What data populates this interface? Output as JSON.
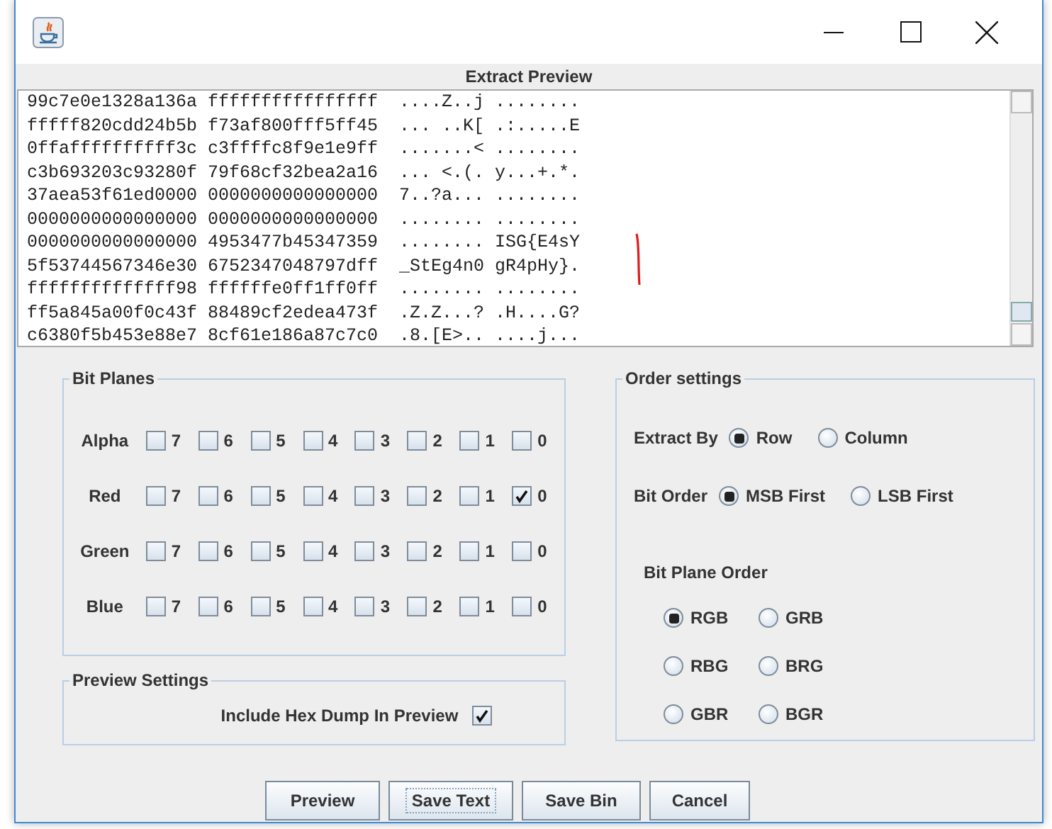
{
  "preview": {
    "title": "Extract Preview",
    "lines": [
      "99c7e0e1328a136a ffffffffffffffff  ....Z..j ........",
      "fffff820cdd24b5b f73af800fff5ff45  ... ..K[ .:.....E",
      "0ffaffffffffff3c c3ffffc8f9e1e9ff  .......< ........",
      "c3b693203c93280f 79f68cf32bea2a16  ... <.(. y...+.*.",
      "37aea53f61ed0000 0000000000000000  7..?a... ........",
      "0000000000000000 0000000000000000  ........ ........",
      "0000000000000000 4953477b45347359  ........ ISG{E4sY",
      "5f53744567346e30 6752347048797dff  _StEg4n0 gR4pHy}.",
      "ffffffffffffff98 ffffffe0ff1ff0ff  ........ ........",
      "ff5a845a00f0c43f 88489cf2edea473f  .Z.Z...? .H....G?",
      "c6380f5b453e88e7 8cf61e186a87c7c0  .8.[E>.. ....j..."
    ]
  },
  "bit_planes": {
    "title": "Bit Planes",
    "rows": [
      {
        "label": "Alpha",
        "bits": [
          {
            "label": "7",
            "checked": false
          },
          {
            "label": "6",
            "checked": false
          },
          {
            "label": "5",
            "checked": false
          },
          {
            "label": "4",
            "checked": false
          },
          {
            "label": "3",
            "checked": false
          },
          {
            "label": "2",
            "checked": false
          },
          {
            "label": "1",
            "checked": false
          },
          {
            "label": "0",
            "checked": false
          }
        ]
      },
      {
        "label": "Red",
        "bits": [
          {
            "label": "7",
            "checked": false
          },
          {
            "label": "6",
            "checked": false
          },
          {
            "label": "5",
            "checked": false
          },
          {
            "label": "4",
            "checked": false
          },
          {
            "label": "3",
            "checked": false
          },
          {
            "label": "2",
            "checked": false
          },
          {
            "label": "1",
            "checked": false
          },
          {
            "label": "0",
            "checked": true
          }
        ]
      },
      {
        "label": "Green",
        "bits": [
          {
            "label": "7",
            "checked": false
          },
          {
            "label": "6",
            "checked": false
          },
          {
            "label": "5",
            "checked": false
          },
          {
            "label": "4",
            "checked": false
          },
          {
            "label": "3",
            "checked": false
          },
          {
            "label": "2",
            "checked": false
          },
          {
            "label": "1",
            "checked": false
          },
          {
            "label": "0",
            "checked": false
          }
        ]
      },
      {
        "label": "Blue",
        "bits": [
          {
            "label": "7",
            "checked": false
          },
          {
            "label": "6",
            "checked": false
          },
          {
            "label": "5",
            "checked": false
          },
          {
            "label": "4",
            "checked": false
          },
          {
            "label": "3",
            "checked": false
          },
          {
            "label": "2",
            "checked": false
          },
          {
            "label": "1",
            "checked": false
          },
          {
            "label": "0",
            "checked": false
          }
        ]
      }
    ]
  },
  "preview_settings": {
    "title": "Preview Settings",
    "option": {
      "label": "Include Hex Dump In Preview",
      "checked": true
    }
  },
  "order_settings": {
    "title": "Order settings",
    "extract_by": {
      "label": "Extract By",
      "options": [
        {
          "label": "Row",
          "selected": true
        },
        {
          "label": "Column",
          "selected": false
        }
      ]
    },
    "bit_order": {
      "label": "Bit Order",
      "options": [
        {
          "label": "MSB First",
          "selected": true
        },
        {
          "label": "LSB First",
          "selected": false
        }
      ]
    },
    "bit_plane_order": {
      "title": "Bit Plane Order",
      "options": [
        {
          "label": "RGB",
          "selected": true
        },
        {
          "label": "GRB",
          "selected": false
        },
        {
          "label": "RBG",
          "selected": false
        },
        {
          "label": "BRG",
          "selected": false
        },
        {
          "label": "GBR",
          "selected": false
        },
        {
          "label": "BGR",
          "selected": false
        }
      ]
    }
  },
  "buttons": [
    {
      "label": "Preview",
      "focused": false
    },
    {
      "label": "Save Text",
      "focused": true
    },
    {
      "label": "Save Bin",
      "focused": false
    },
    {
      "label": "Cancel",
      "focused": false
    }
  ]
}
